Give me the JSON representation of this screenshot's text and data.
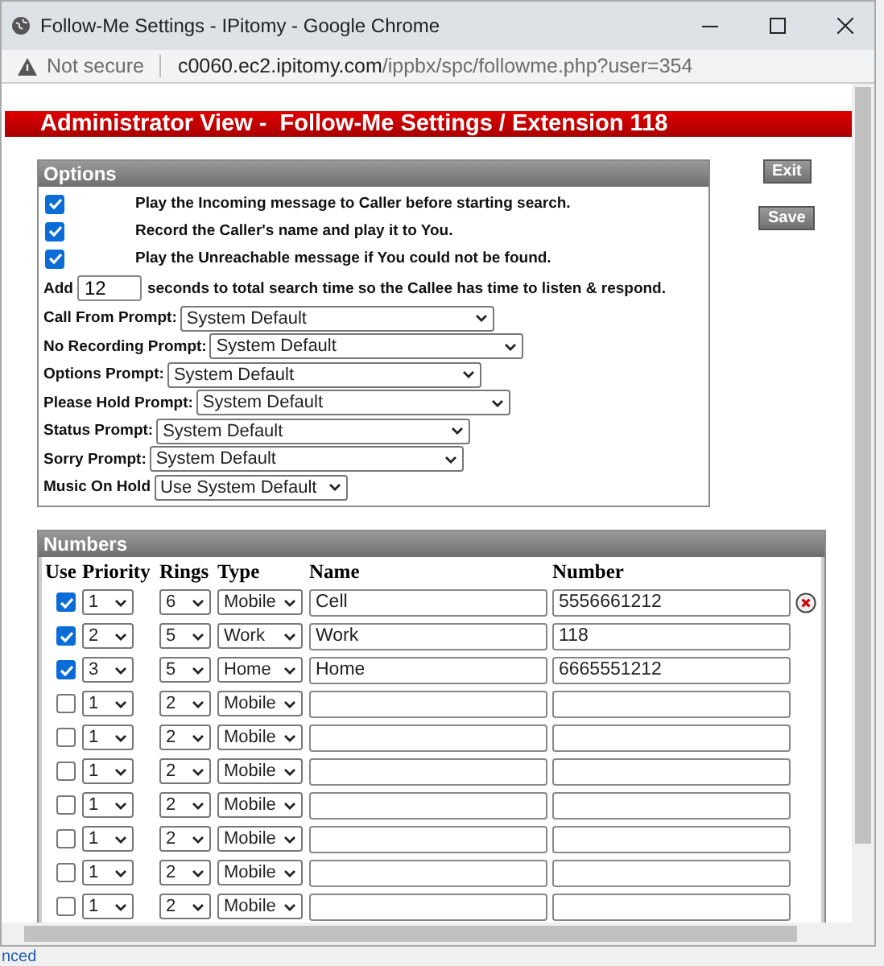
{
  "window": {
    "title": "Follow-Me Settings - IPitomy - Google Chrome",
    "security": "Not secure",
    "url_host": "c0060.ec2.ipitomy.com",
    "url_path": "/ippbx/spc/followme.php?user=354"
  },
  "banner": "Administrator View -  Follow-Me Settings / Extension 118",
  "buttons": [
    "Exit",
    "Save"
  ],
  "options": {
    "title": "Options",
    "checks": [
      {
        "label": "Play the Incoming message to Caller before starting search.",
        "checked": true
      },
      {
        "label": "Record the Caller's name and play it to You.",
        "checked": true
      },
      {
        "label": "Play the Unreachable message if You could not be found.",
        "checked": true
      }
    ],
    "add_label": "Add",
    "add_value": "12",
    "add_suffix": "seconds to total search time so the Callee has time to listen & respond.",
    "prompts": [
      {
        "label": "Call From Prompt:",
        "value": "System Default"
      },
      {
        "label": "No Recording Prompt:",
        "value": "System Default"
      },
      {
        "label": "Options Prompt:",
        "value": "System Default"
      },
      {
        "label": "Please Hold Prompt:",
        "value": "System Default"
      },
      {
        "label": "Status Prompt:",
        "value": "System Default"
      },
      {
        "label": "Sorry Prompt:",
        "value": "System Default"
      },
      {
        "label": "Music On Hold",
        "value": "Use System Default"
      }
    ]
  },
  "numbers": {
    "title": "Numbers",
    "columns": [
      "Use",
      "Priority",
      "Rings",
      "Type",
      "Name",
      "Number"
    ],
    "rows": [
      {
        "use": true,
        "priority": "1",
        "rings": "6",
        "type": "Mobile",
        "name": "Cell",
        "number": "5556661212",
        "deletable": true
      },
      {
        "use": true,
        "priority": "2",
        "rings": "5",
        "type": "Work",
        "name": "Work",
        "number": "118",
        "deletable": false
      },
      {
        "use": true,
        "priority": "3",
        "rings": "5",
        "type": "Home",
        "name": "Home",
        "number": "6665551212",
        "deletable": false
      },
      {
        "use": false,
        "priority": "1",
        "rings": "2",
        "type": "Mobile",
        "name": "",
        "number": "",
        "deletable": false
      },
      {
        "use": false,
        "priority": "1",
        "rings": "2",
        "type": "Mobile",
        "name": "",
        "number": "",
        "deletable": false
      },
      {
        "use": false,
        "priority": "1",
        "rings": "2",
        "type": "Mobile",
        "name": "",
        "number": "",
        "deletable": false
      },
      {
        "use": false,
        "priority": "1",
        "rings": "2",
        "type": "Mobile",
        "name": "",
        "number": "",
        "deletable": false
      },
      {
        "use": false,
        "priority": "1",
        "rings": "2",
        "type": "Mobile",
        "name": "",
        "number": "",
        "deletable": false
      },
      {
        "use": false,
        "priority": "1",
        "rings": "2",
        "type": "Mobile",
        "name": "",
        "number": "",
        "deletable": false
      },
      {
        "use": false,
        "priority": "1",
        "rings": "2",
        "type": "Mobile",
        "name": "",
        "number": "",
        "deletable": false
      }
    ]
  },
  "background_link": "nced"
}
